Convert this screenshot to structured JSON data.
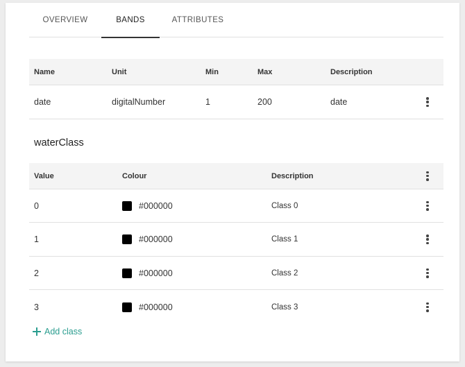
{
  "tabs": [
    {
      "label": "OVERVIEW",
      "active": false
    },
    {
      "label": "BANDS",
      "active": true
    },
    {
      "label": "ATTRIBUTES",
      "active": false
    }
  ],
  "bands_table": {
    "headers": {
      "name": "Name",
      "unit": "Unit",
      "min": "Min",
      "max": "Max",
      "description": "Description"
    },
    "rows": [
      {
        "name": "date",
        "unit": "digitalNumber",
        "min": "1",
        "max": "200",
        "description": "date"
      }
    ]
  },
  "class_section": {
    "title": "waterClass",
    "headers": {
      "value": "Value",
      "colour": "Colour",
      "description": "Description"
    },
    "rows": [
      {
        "value": "0",
        "colour": "#000000",
        "description": "Class 0"
      },
      {
        "value": "1",
        "colour": "#000000",
        "description": "Class 1"
      },
      {
        "value": "2",
        "colour": "#000000",
        "description": "Class 2"
      },
      {
        "value": "3",
        "colour": "#000000",
        "description": "Class 3"
      }
    ],
    "add_label": "Add class"
  },
  "colors": {
    "accent": "#2a9d8f",
    "header_bg": "#f4f4f4",
    "divider": "#e0e0e0"
  }
}
